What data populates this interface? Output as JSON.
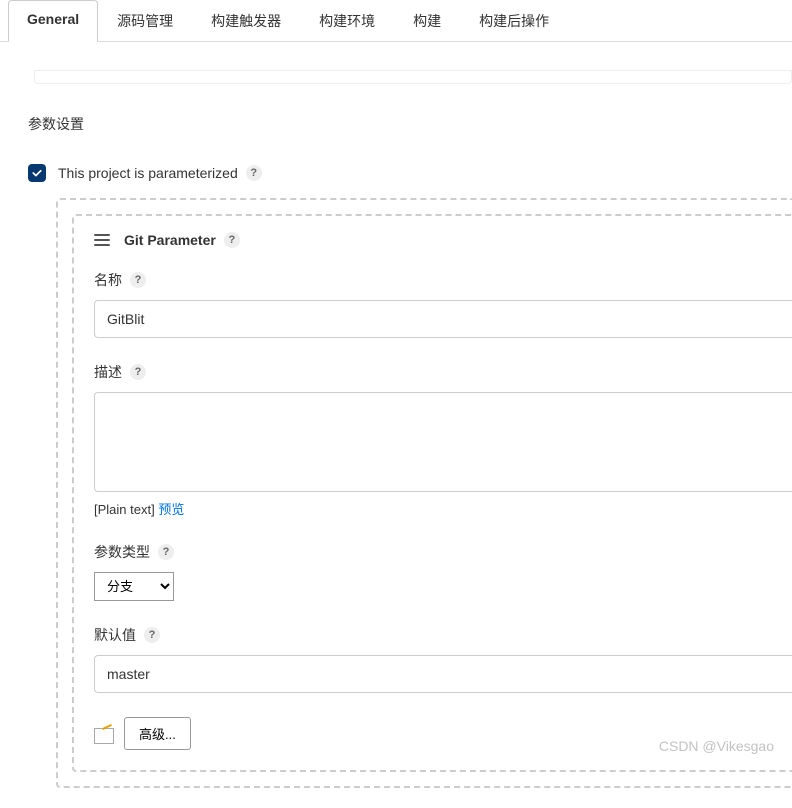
{
  "tabs": {
    "general": "General",
    "scm": "源码管理",
    "triggers": "构建触发器",
    "env": "构建环境",
    "build": "构建",
    "post": "构建后操作"
  },
  "section": {
    "title": "参数设置"
  },
  "checkbox": {
    "label": "This project is parameterized"
  },
  "param": {
    "title": "Git Parameter",
    "name_label": "名称",
    "name_value": "GitBlit",
    "desc_label": "描述",
    "desc_value": "",
    "plain_text": "[Plain text]",
    "preview": "预览",
    "type_label": "参数类型",
    "type_value": "分支",
    "default_label": "默认值",
    "default_value": "master",
    "advanced": "高级..."
  },
  "watermark": "CSDN @Vikesgao"
}
